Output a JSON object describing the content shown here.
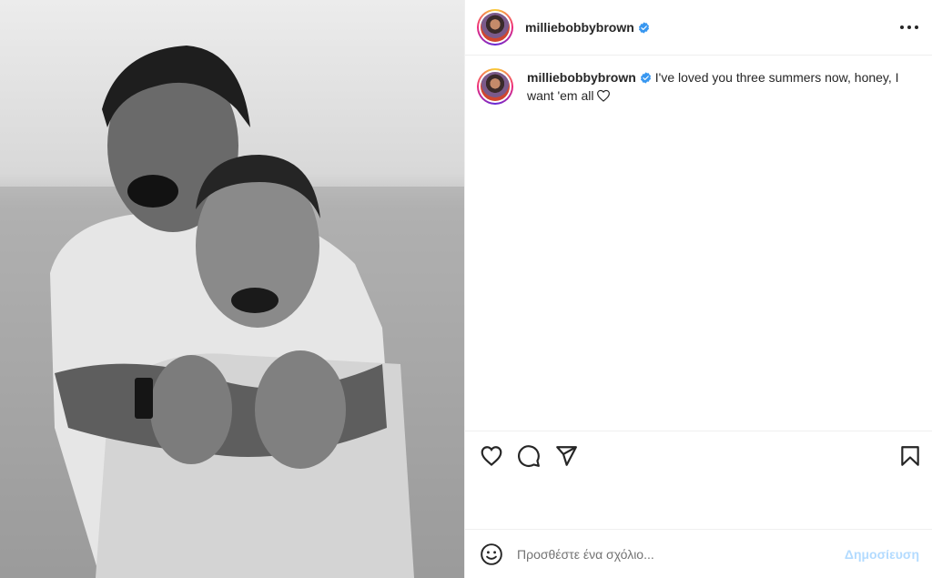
{
  "post": {
    "username": "milliebobbybrown",
    "verified": true,
    "caption": "I've loved you three summers now, honey, I want 'em all",
    "photo_style": "black-and-white"
  },
  "icons": {
    "more": "more-options-icon",
    "like": "heart-icon",
    "comment": "comment-icon",
    "share": "share-icon",
    "save": "bookmark-icon",
    "emoji": "emoji-icon",
    "verified": "verified-badge-icon"
  },
  "comment_box": {
    "placeholder": "Προσθέστε ένα σχόλιο...",
    "post_label": "Δημοσίευση"
  },
  "colors": {
    "verified_blue": "#3897f0",
    "post_button_disabled": "#b3dbff",
    "text": "#262626",
    "placeholder": "#737373"
  }
}
